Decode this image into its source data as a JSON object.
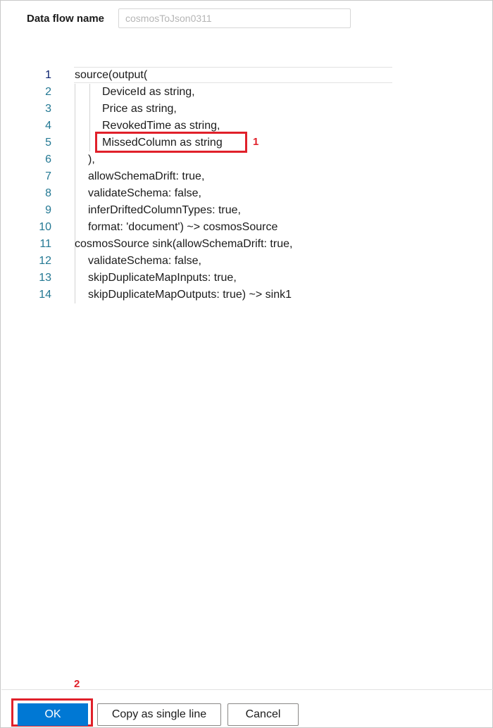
{
  "form": {
    "name_label": "Data flow name",
    "name_value": "cosmosToJson0311"
  },
  "editor": {
    "lines": [
      {
        "number": "1",
        "text": "source(output("
      },
      {
        "number": "2",
        "text": "DeviceId as string,"
      },
      {
        "number": "3",
        "text": "Price as string,"
      },
      {
        "number": "4",
        "text": "RevokedTime as string,"
      },
      {
        "number": "5",
        "text": "MissedColumn as string"
      },
      {
        "number": "6",
        "text": "),"
      },
      {
        "number": "7",
        "text": "allowSchemaDrift: true,"
      },
      {
        "number": "8",
        "text": "validateSchema: false,"
      },
      {
        "number": "9",
        "text": "inferDriftedColumnTypes: true,"
      },
      {
        "number": "10",
        "text": "format: 'document') ~> cosmosSource"
      },
      {
        "number": "11",
        "text": "cosmosSource sink(allowSchemaDrift: true,"
      },
      {
        "number": "12",
        "text": "validateSchema: false,"
      },
      {
        "number": "13",
        "text": "skipDuplicateMapInputs: true,"
      },
      {
        "number": "14",
        "text": "skipDuplicateMapOutputs: true) ~> sink1"
      }
    ]
  },
  "annotations": {
    "step1": "1",
    "step2": "2",
    "color": "#e0202a"
  },
  "footer": {
    "ok_label": "OK",
    "copy_label": "Copy as single line",
    "cancel_label": "Cancel"
  },
  "colors": {
    "primary": "#0078d4",
    "line_number": "#237893"
  }
}
